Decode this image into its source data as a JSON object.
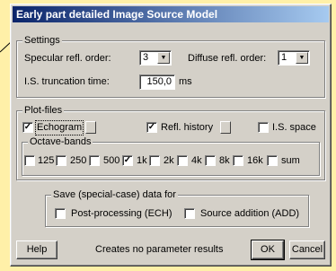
{
  "window": {
    "title": "Early part detailed Image Source Model"
  },
  "settings": {
    "legend": "Settings",
    "specular_label": "Specular refl. order:",
    "specular_value": "3",
    "diffuse_label": "Diffuse refl. order:",
    "diffuse_value": "1",
    "truncation_label": "I.S. truncation time:",
    "truncation_value": "150,0",
    "truncation_unit": "ms"
  },
  "plotfiles": {
    "legend": "Plot-files",
    "echogram_label": "Echogram",
    "echogram_checked": true,
    "refl_history_label": "Refl. history",
    "refl_history_checked": true,
    "is_space_label": "I.S. space",
    "is_space_checked": false,
    "octave_legend": "Octave-bands",
    "bands": [
      {
        "label": "125",
        "checked": false
      },
      {
        "label": "250",
        "checked": false
      },
      {
        "label": "500",
        "checked": false
      },
      {
        "label": "1k",
        "checked": true
      },
      {
        "label": "2k",
        "checked": false
      },
      {
        "label": "4k",
        "checked": false
      },
      {
        "label": "8k",
        "checked": false
      },
      {
        "label": "16k",
        "checked": false
      },
      {
        "label": "sum",
        "checked": false
      }
    ]
  },
  "save": {
    "legend": "Save (special-case) data for",
    "post_label": "Post-processing (ECH)",
    "post_checked": false,
    "source_label": "Source addition (ADD)",
    "source_checked": false
  },
  "footer": {
    "help_label": "Help",
    "status_text": "Creates no parameter results",
    "ok_label": "OK",
    "cancel_label": "Cancel"
  },
  "colors": {
    "background": "#fff0a8",
    "dialog": "#d4d0c8",
    "title_start": "#0a246a",
    "title_end": "#a6caf0"
  }
}
